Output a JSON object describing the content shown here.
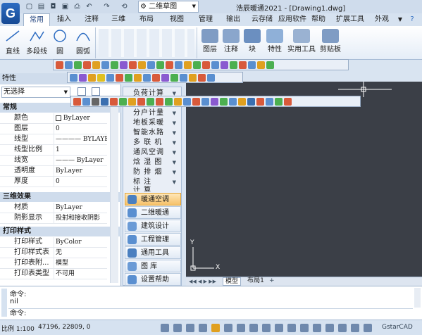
{
  "app": {
    "title": "浩辰暖通2021 - [Drawing1.dwg]",
    "workspace": "二维草图",
    "logo": "G"
  },
  "quick_access": [
    "new-icon",
    "open-icon",
    "save-icon",
    "undo-icon",
    "redo-icon",
    "sync-icon"
  ],
  "tabs": [
    "常用",
    "插入",
    "注释",
    "三维",
    "布局",
    "视图",
    "管理",
    "输出",
    "云存储",
    "应用软件",
    "帮助",
    "扩展工具",
    "外观"
  ],
  "ribbon": {
    "draw": [
      {
        "label": "直线",
        "icon": "line-icon"
      },
      {
        "label": "多段线",
        "icon": "polyline-icon"
      },
      {
        "label": "圆",
        "icon": "circle-icon"
      },
      {
        "label": "圆弧",
        "icon": "arc-icon"
      }
    ],
    "groups": [
      {
        "label": "图层",
        "icon": "layers-icon"
      },
      {
        "label": "注释",
        "icon": "annotation-icon"
      },
      {
        "label": "块",
        "icon": "block-icon"
      },
      {
        "label": "特性",
        "icon": "properties-icon"
      },
      {
        "label": "实用工具",
        "icon": "utilities-icon"
      },
      {
        "label": "剪贴板",
        "icon": "clipboard-icon"
      }
    ]
  },
  "properties": {
    "title": "特性",
    "selection": "无选择",
    "sections": [
      {
        "title": "常规",
        "rows": [
          {
            "k": "颜色",
            "v": "ByLayer"
          },
          {
            "k": "图层",
            "v": "0"
          },
          {
            "k": "线型",
            "v": "———— BYLAYER"
          },
          {
            "k": "线型比例",
            "v": "1"
          },
          {
            "k": "线宽",
            "v": "——— ByLayer"
          },
          {
            "k": "透明度",
            "v": "ByLayer"
          },
          {
            "k": "厚度",
            "v": "0"
          }
        ]
      },
      {
        "title": "三维效果",
        "rows": [
          {
            "k": "材质",
            "v": "ByLayer"
          },
          {
            "k": "阴影显示",
            "v": "投射和接收阴影"
          }
        ]
      },
      {
        "title": "打印样式",
        "rows": [
          {
            "k": "打印样式",
            "v": "ByColor"
          },
          {
            "k": "打印样式表",
            "v": "无"
          },
          {
            "k": "打印表附...",
            "v": "模型"
          },
          {
            "k": "打印表类型",
            "v": "不可用"
          }
        ]
      }
    ]
  },
  "menu": {
    "items": [
      "负荷计算",
      "分户计量",
      "地板采暖",
      "智能水路",
      "多 联 机",
      "通风空调",
      "焓 湿 图",
      "防 排 烟",
      "标    注",
      "计   算"
    ],
    "big": [
      {
        "label": "暖通空调",
        "icon": "hvac-icon"
      },
      {
        "label": "二维暖通",
        "icon": "hvac2d-icon"
      },
      {
        "label": "建筑设计",
        "icon": "architecture-icon"
      },
      {
        "label": "工程管理",
        "icon": "project-icon"
      },
      {
        "label": "通用工具",
        "icon": "tools-icon"
      },
      {
        "label": "图    库",
        "icon": "library-icon"
      },
      {
        "label": "设置帮助",
        "icon": "help-icon"
      }
    ]
  },
  "layout_tabs": [
    "模型",
    "布局1"
  ],
  "command": {
    "lines": [
      "命令:",
      "nil",
      "命令:"
    ]
  },
  "status": {
    "scale": "比例 1:100",
    "coords": "47196, 22809, 0",
    "brand": "GstarCAD"
  },
  "ucs": {
    "y": "Y",
    "x": "X"
  }
}
